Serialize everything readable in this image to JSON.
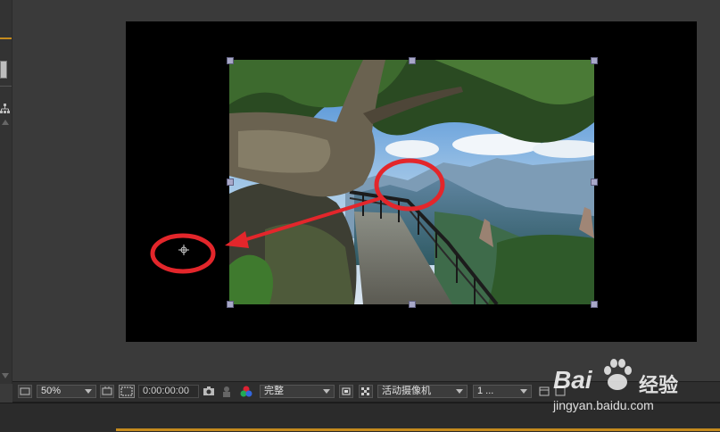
{
  "toolbar": {
    "zoom": "50%",
    "timecode": "0:00:00:00",
    "resolution": "完整",
    "camera": "活动摄像机",
    "views": "1 ..."
  },
  "watermark": {
    "brand_left": "Bai",
    "brand_right": "经验",
    "url": "jingyan.baidu.com"
  },
  "colors": {
    "panel": "#3a3a3a",
    "comp_bg": "#000000",
    "accent": "#c58b1e",
    "annotation": "#e3262b"
  }
}
